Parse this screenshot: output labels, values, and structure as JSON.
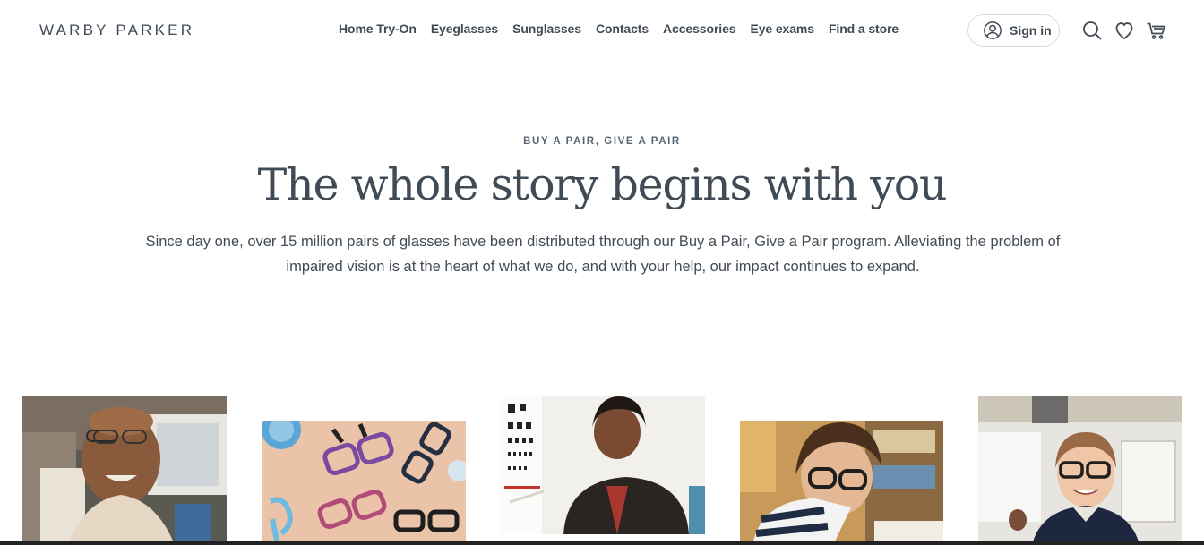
{
  "brand": {
    "logo_text": "WARBY PARKER"
  },
  "nav": {
    "items": [
      {
        "label": "Home Try-On"
      },
      {
        "label": "Eyeglasses"
      },
      {
        "label": "Sunglasses"
      },
      {
        "label": "Contacts"
      },
      {
        "label": "Accessories"
      },
      {
        "label": "Eye exams"
      },
      {
        "label": "Find a store"
      }
    ]
  },
  "account": {
    "sign_in_label": "Sign in"
  },
  "icons": [
    "user-icon",
    "search-icon",
    "heart-icon",
    "cart-icon"
  ],
  "hero": {
    "eyebrow": "BUY A PAIR, GIVE A PAIR",
    "headline": "The whole story begins with you",
    "body": "Since day one, over 15 million pairs of glasses have been distributed through our Buy a Pair, Give a Pair program. Alleviating the problem of impaired vision is at the heart of what we do, and with your help, our impact continues to expand."
  },
  "gallery": {
    "photos": [
      {
        "subject": "elderly-man-wearing-glasses"
      },
      {
        "subject": "assorted-eyeglass-frames"
      },
      {
        "subject": "woman-pointing-at-eye-chart"
      },
      {
        "subject": "girl-reading-with-glasses"
      },
      {
        "subject": "boy-smiling-with-glasses"
      }
    ]
  },
  "colors": {
    "text": "#414b56",
    "border": "#d8dde2",
    "background": "#ffffff"
  }
}
